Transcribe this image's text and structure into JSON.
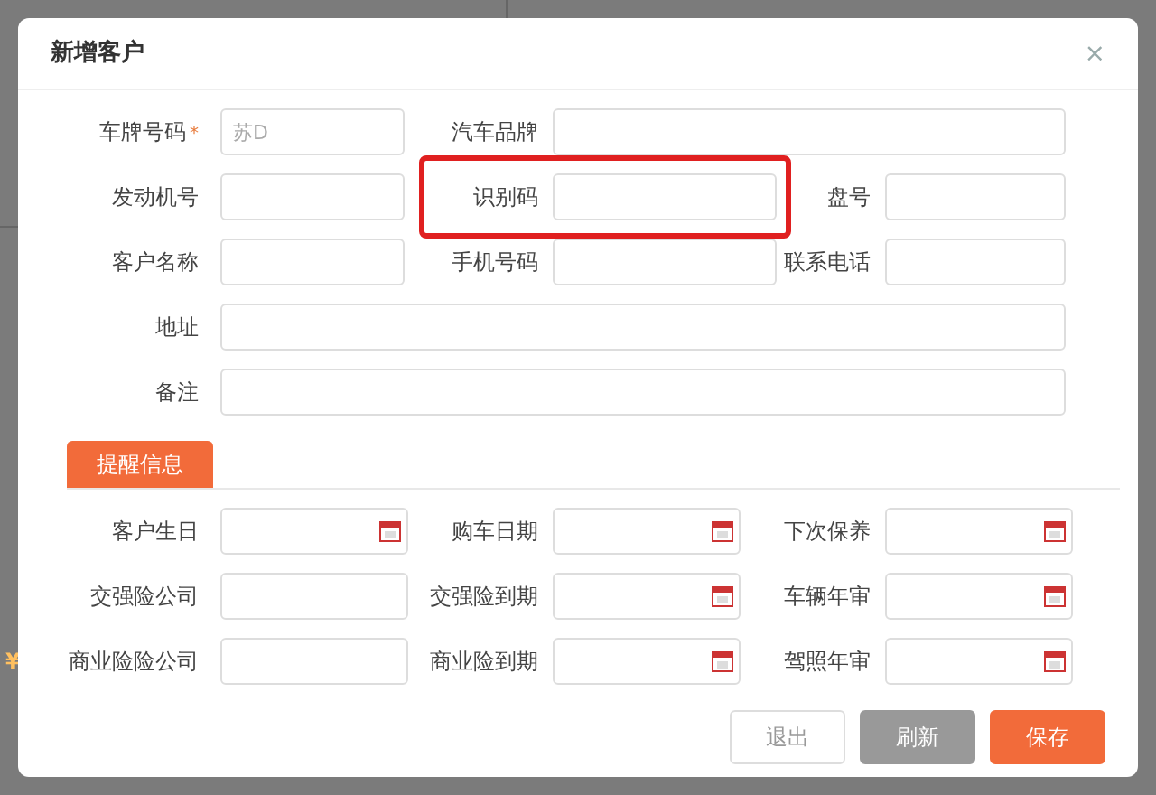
{
  "background": {
    "text": "¥"
  },
  "dialog": {
    "title": "新增客户",
    "close": "×"
  },
  "customer_rows": [
    [
      {
        "label": "车牌号码",
        "required_mark": "*",
        "placeholder": "苏D",
        "highlighted": false
      },
      {
        "label": "汽车品牌",
        "highlighted": false
      }
    ],
    [
      {
        "label": "发动机号",
        "highlighted": false
      },
      {
        "label": "识别码",
        "highlighted": true
      },
      {
        "label": "盘号",
        "highlighted": false
      }
    ],
    [
      {
        "label": "客户名称",
        "highlighted": false
      },
      {
        "label": "手机号码",
        "highlighted": false
      },
      {
        "label": "联系电话",
        "highlighted": false
      }
    ],
    [
      {
        "label": "地址",
        "highlighted": false
      }
    ],
    [
      {
        "label": "备注",
        "highlighted": false
      }
    ]
  ],
  "tabs": [
    {
      "label": "提醒信息",
      "selected": true
    }
  ],
  "reminder_rows": [
    [
      {
        "label": "客户生日",
        "kind": "date"
      },
      {
        "label": "购车日期",
        "kind": "date"
      },
      {
        "label": "下次保养",
        "kind": "date"
      }
    ],
    [
      {
        "label": "交强险公司",
        "kind": "text"
      },
      {
        "label": "交强险到期",
        "kind": "date"
      },
      {
        "label": "车辆年审",
        "kind": "date"
      }
    ],
    [
      {
        "label": "商业险险公司",
        "kind": "text"
      },
      {
        "label": "商业险到期",
        "kind": "date"
      },
      {
        "label": "驾照年审",
        "kind": "date"
      }
    ]
  ],
  "buttons": [
    {
      "label": "退出",
      "kind": "default"
    },
    {
      "label": "刷新",
      "kind": "secondary"
    },
    {
      "label": "保存",
      "kind": "primary"
    }
  ]
}
